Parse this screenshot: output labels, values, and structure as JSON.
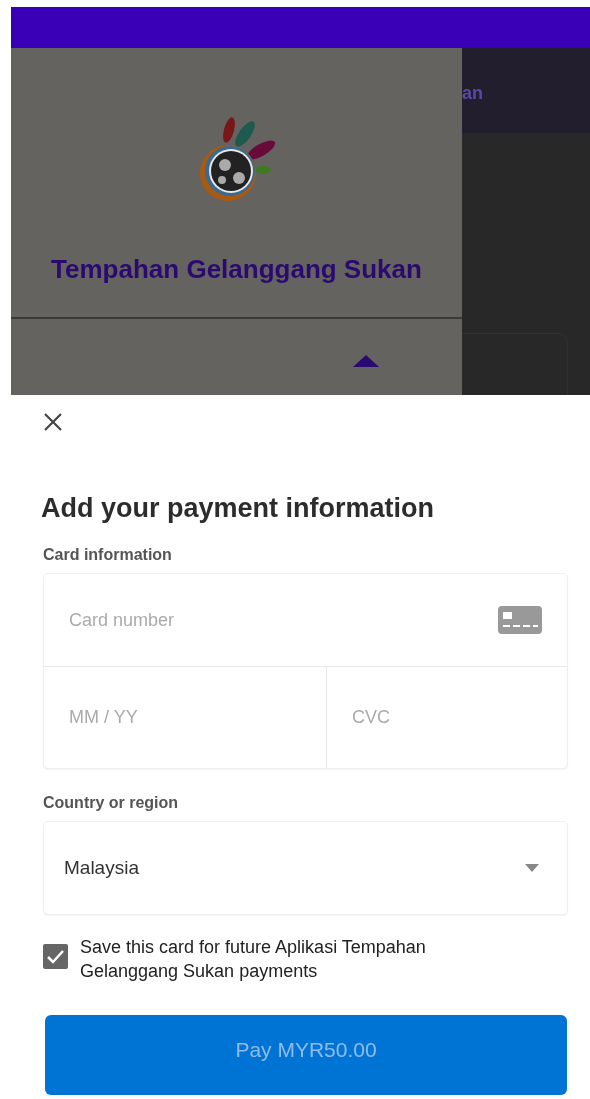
{
  "drawer": {
    "title": "Tempahan Gelanggang Sukan"
  },
  "background_header": {
    "title_fragment": "an"
  },
  "sheet": {
    "title": "Add your payment information",
    "card_label": "Card information",
    "card_number": {
      "placeholder": "Card number"
    },
    "expiry": {
      "placeholder": "MM / YY"
    },
    "cvc": {
      "placeholder": "CVC"
    },
    "country_label": "Country or region",
    "country": {
      "value": "Malaysia"
    },
    "save_card": {
      "label": "Save this card for future Aplikasi Tempahan Gelanggang Sukan payments",
      "checked": true
    },
    "pay_button": {
      "label": "Pay MYR50.00",
      "disabled": true
    }
  }
}
